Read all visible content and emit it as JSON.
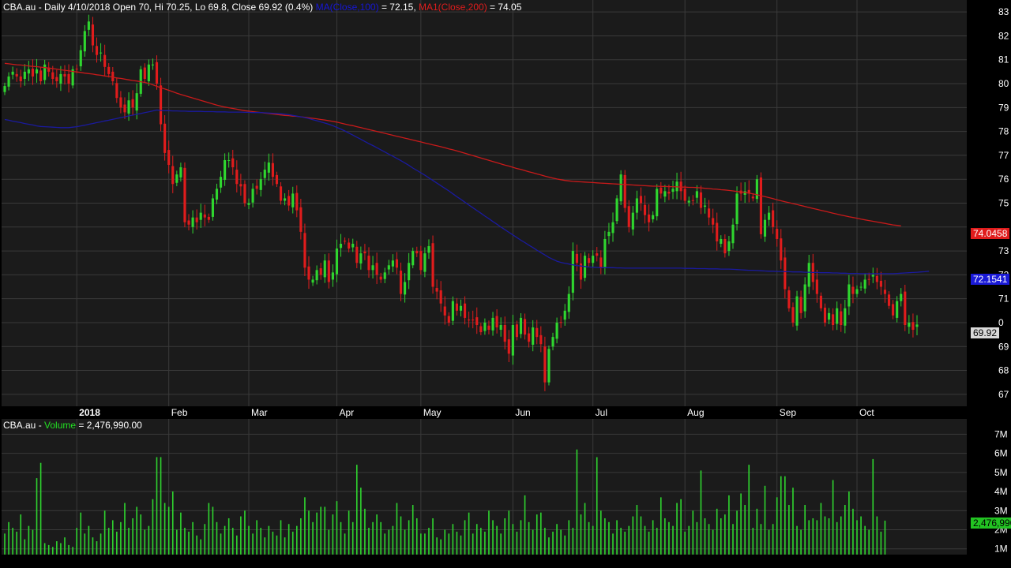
{
  "header": {
    "symbol": "CBA.au",
    "quote_text": " - Daily 4/10/2018 Open 70, Hi 70.25, Lo 69.8, Close 69.92 (0.4%) ",
    "ma100_label": "MA(Close,100)",
    "ma100_value_text": " = 72.15, ",
    "ma200_label": "MA1(Close,200)",
    "ma200_value_text": " = 74.05"
  },
  "volume_header": {
    "symbol": "CBA.au",
    "separator": " - ",
    "label": "Volume",
    "value_text": " = 2,476,990.00"
  },
  "badges": {
    "ma200": "74.0458",
    "ma100": "72.1541",
    "last_close": "69.92",
    "volume": "2,476,990"
  },
  "colors": {
    "background": "#000000",
    "panel": "#1b1b1b",
    "grid": "#3a3a3a",
    "up": "#2fd62f",
    "down": "#e01c1c",
    "ma100": "#1a1a9e",
    "ma200": "#c81a1a",
    "volume": "#2fd62f",
    "text": "#ffffff"
  },
  "chart_data": [
    {
      "type": "candlestick",
      "title": "CBA.au Daily",
      "ylim": [
        66.5,
        83.5
      ],
      "y_ticks": [
        67,
        68,
        69,
        70,
        71,
        72,
        73,
        74,
        75,
        76,
        77,
        78,
        79,
        80,
        81,
        82,
        83
      ],
      "y_tick_labels": [
        "67",
        "68",
        "69",
        "0",
        "71",
        "72",
        "73",
        "",
        "75",
        "76",
        "77",
        "78",
        "79",
        "80",
        "81",
        "82",
        "83"
      ],
      "x_month_labels": [
        {
          "label": "2018",
          "bar": 18
        },
        {
          "label": "Feb",
          "bar": 41
        },
        {
          "label": "Mar",
          "bar": 61
        },
        {
          "label": "Apr",
          "bar": 83
        },
        {
          "label": "May",
          "bar": 104
        },
        {
          "label": "Jun",
          "bar": 127
        },
        {
          "label": "Jul",
          "bar": 147
        },
        {
          "label": "Aug",
          "bar": 170
        },
        {
          "label": "Sep",
          "bar": 193
        },
        {
          "label": "Oct",
          "bar": 213
        }
      ],
      "close": [
        79.9,
        80.3,
        80.5,
        80.3,
        80.1,
        80.5,
        80.6,
        80.3,
        80.6,
        80.1,
        80.8,
        80.5,
        80.2,
        80.1,
        80.4,
        80.3,
        80.0,
        80.6,
        80.6,
        81.4,
        82.2,
        82.6,
        81.6,
        81.2,
        81.3,
        80.7,
        80.4,
        80.1,
        79.4,
        79.0,
        78.8,
        79.3,
        79.0,
        79.6,
        80.6,
        80.2,
        80.8,
        80.8,
        80.0,
        78.3,
        77.1,
        76.6,
        75.8,
        76.2,
        76.5,
        74.2,
        74.1,
        74.4,
        74.2,
        74.6,
        74.4,
        74.3,
        75.2,
        75.6,
        76.1,
        76.8,
        76.8,
        76.5,
        75.8,
        75.7,
        75.0,
        75.0,
        75.6,
        75.6,
        76.0,
        76.4,
        76.7,
        76.1,
        75.8,
        75.1,
        75.2,
        74.9,
        75.4,
        74.7,
        73.8,
        72.3,
        71.8,
        71.8,
        72.2,
        72.0,
        72.6,
        71.7,
        72.1,
        73.1,
        73.3,
        73.4,
        73.1,
        73.3,
        72.5,
        72.9,
        72.9,
        72.2,
        72.4,
        72.0,
        71.8,
        72.1,
        72.4,
        72.6,
        72.3,
        71.2,
        71.7,
        72.5,
        73.0,
        72.9,
        72.2,
        72.9,
        73.2,
        71.5,
        71.3,
        70.8,
        70.3,
        70.0,
        70.9,
        70.5,
        70.7,
        70.2,
        70.1,
        70.1,
        69.9,
        69.6,
        70.0,
        69.7,
        70.2,
        69.8,
        69.9,
        69.2,
        68.7,
        69.9,
        69.4,
        70.2,
        69.5,
        69.2,
        69.8,
        69.4,
        69.1,
        67.5,
        68.9,
        69.4,
        70.0,
        70.0,
        70.5,
        71.2,
        73.0,
        72.5,
        71.8,
        72.8,
        72.5,
        72.8,
        72.8,
        72.3,
        73.5,
        73.8,
        74.2,
        75.2,
        76.2,
        74.8,
        74.0,
        74.6,
        75.2,
        75.0,
        74.5,
        74.2,
        74.5,
        75.6,
        75.4,
        75.5,
        75.4,
        75.6,
        75.9,
        75.5,
        75.1,
        75.1,
        75.1,
        75.5,
        74.8,
        74.9,
        74.4,
        74.1,
        73.4,
        73.5,
        72.9,
        73.4,
        74.1,
        75.4,
        75.4,
        75.5,
        75.4,
        75.2,
        76.0,
        73.7,
        74.3,
        74.6,
        74.0,
        73.5,
        72.6,
        71.4,
        70.6,
        70.0,
        71.1,
        70.4,
        71.6,
        72.5,
        71.7,
        71.2,
        70.6,
        70.0,
        70.4,
        69.9,
        70.6,
        69.9,
        70.6,
        71.6,
        71.2,
        71.4,
        71.5,
        71.8,
        71.8,
        72.0,
        71.7,
        71.5,
        71.2,
        70.7,
        70.3,
        70.9,
        71.2,
        69.9,
        70.0,
        69.7,
        69.92
      ],
      "ma100": [
        78.5,
        78.47,
        78.43,
        78.4,
        78.37,
        78.33,
        78.3,
        78.27,
        78.23,
        78.21,
        78.2,
        78.19,
        78.18,
        78.17,
        78.16,
        78.16,
        78.16,
        78.18,
        78.2,
        78.23,
        78.26,
        78.3,
        78.33,
        78.37,
        78.4,
        78.44,
        78.47,
        78.51,
        78.54,
        78.58,
        78.61,
        78.65,
        78.68,
        78.72,
        78.75,
        78.79,
        78.82,
        78.86,
        78.9,
        78.88,
        78.87,
        78.87,
        78.86,
        78.86,
        78.85,
        78.85,
        78.84,
        78.84,
        78.84,
        78.84,
        78.83,
        78.83,
        78.83,
        78.82,
        78.82,
        78.82,
        78.81,
        78.81,
        78.81,
        78.81,
        78.8,
        78.8,
        78.79,
        78.79,
        78.79,
        78.78,
        78.77,
        78.76,
        78.75,
        78.74,
        78.72,
        78.7,
        78.67,
        78.64,
        78.61,
        78.58,
        78.54,
        78.49,
        78.45,
        78.4,
        78.35,
        78.3,
        78.24,
        78.17,
        78.1,
        78.02,
        77.93,
        77.85,
        77.76,
        77.67,
        77.58,
        77.49,
        77.41,
        77.32,
        77.23,
        77.14,
        77.05,
        76.96,
        76.87,
        76.78,
        76.68,
        76.58,
        76.47,
        76.37,
        76.27,
        76.17,
        76.06,
        75.95,
        75.84,
        75.73,
        75.62,
        75.51,
        75.39,
        75.27,
        75.16,
        75.04,
        74.92,
        74.81,
        74.69,
        74.58,
        74.46,
        74.35,
        74.23,
        74.12,
        74.0,
        73.89,
        73.78,
        73.67,
        73.56,
        73.45,
        73.35,
        73.24,
        73.14,
        73.03,
        72.93,
        72.83,
        72.73,
        72.65,
        72.57,
        72.52,
        72.48,
        72.45,
        72.42,
        72.39,
        72.37,
        72.35,
        72.33,
        72.32,
        72.31,
        72.3,
        72.3,
        72.3,
        72.3,
        72.29,
        72.29,
        72.28,
        72.28,
        72.28,
        72.28,
        72.28,
        72.28,
        72.28,
        72.28,
        72.28,
        72.28,
        72.28,
        72.28,
        72.28,
        72.28,
        72.28,
        72.27,
        72.27,
        72.27,
        72.26,
        72.26,
        72.26,
        72.25,
        72.25,
        72.25,
        72.24,
        72.24,
        72.24,
        72.23,
        72.22,
        72.21,
        72.2,
        72.19,
        72.19,
        72.18,
        72.17,
        72.16,
        72.15,
        72.15,
        72.14,
        72.14,
        72.13,
        72.13,
        72.12,
        72.12,
        72.12,
        72.11,
        72.11,
        72.1,
        72.1,
        72.09,
        72.09,
        72.09,
        72.08,
        72.08,
        72.07,
        72.07,
        72.06,
        72.06,
        72.06,
        72.05,
        72.05,
        72.05,
        72.05,
        72.05,
        72.05,
        72.05,
        72.05,
        72.05,
        72.06,
        72.07,
        72.08,
        72.09,
        72.1,
        72.11,
        72.12,
        72.13,
        72.15
      ],
      "ma200": [
        80.85,
        80.83,
        80.81,
        80.79,
        80.78,
        80.76,
        80.74,
        80.72,
        80.71,
        80.69,
        80.67,
        80.65,
        80.63,
        80.61,
        80.58,
        80.56,
        80.54,
        80.51,
        80.49,
        80.47,
        80.44,
        80.42,
        80.4,
        80.37,
        80.35,
        80.32,
        80.3,
        80.27,
        80.24,
        80.22,
        80.19,
        80.16,
        80.13,
        80.11,
        80.08,
        80.05,
        80.01,
        79.95,
        79.89,
        79.83,
        79.78,
        79.72,
        79.66,
        79.6,
        79.55,
        79.5,
        79.45,
        79.4,
        79.35,
        79.3,
        79.25,
        79.2,
        79.15,
        79.1,
        79.06,
        79.02,
        78.99,
        78.96,
        78.93,
        78.9,
        78.87,
        78.85,
        78.83,
        78.81,
        78.79,
        78.77,
        78.75,
        78.73,
        78.71,
        78.69,
        78.67,
        78.66,
        78.64,
        78.63,
        78.61,
        78.59,
        78.57,
        78.55,
        78.53,
        78.5,
        78.48,
        78.45,
        78.42,
        78.39,
        78.35,
        78.31,
        78.27,
        78.24,
        78.2,
        78.16,
        78.12,
        78.08,
        78.04,
        78.0,
        77.96,
        77.92,
        77.88,
        77.84,
        77.8,
        77.76,
        77.72,
        77.68,
        77.64,
        77.6,
        77.56,
        77.52,
        77.48,
        77.44,
        77.4,
        77.36,
        77.32,
        77.27,
        77.23,
        77.19,
        77.14,
        77.09,
        77.04,
        76.99,
        76.94,
        76.89,
        76.84,
        76.79,
        76.74,
        76.69,
        76.64,
        76.59,
        76.55,
        76.5,
        76.45,
        76.41,
        76.36,
        76.31,
        76.27,
        76.22,
        76.18,
        76.13,
        76.09,
        76.05,
        76.01,
        75.98,
        75.95,
        75.93,
        75.91,
        75.9,
        75.89,
        75.88,
        75.87,
        75.86,
        75.85,
        75.84,
        75.83,
        75.82,
        75.81,
        75.8,
        75.79,
        75.78,
        75.77,
        75.76,
        75.75,
        75.74,
        75.73,
        75.72,
        75.71,
        75.71,
        75.7,
        75.7,
        75.69,
        75.69,
        75.68,
        75.67,
        75.67,
        75.66,
        75.66,
        75.65,
        75.64,
        75.62,
        75.61,
        75.59,
        75.58,
        75.56,
        75.55,
        75.53,
        75.51,
        75.49,
        75.47,
        75.45,
        75.42,
        75.39,
        75.35,
        75.31,
        75.27,
        75.23,
        75.19,
        75.14,
        75.1,
        75.06,
        75.02,
        74.98,
        74.94,
        74.9,
        74.86,
        74.82,
        74.78,
        74.74,
        74.7,
        74.66,
        74.62,
        74.58,
        74.54,
        74.5,
        74.47,
        74.43,
        74.4,
        74.37,
        74.33,
        74.3,
        74.27,
        74.24,
        74.21,
        74.18,
        74.15,
        74.12,
        74.09,
        74.07,
        74.05
      ]
    },
    {
      "type": "bar",
      "title": "Volume",
      "ylim": [
        700000,
        7800000
      ],
      "y_ticks": [
        1000000,
        2000000,
        3000000,
        4000000,
        5000000,
        6000000,
        7000000
      ],
      "y_tick_labels": [
        "1M",
        "2M",
        "3M",
        "4M",
        "5M",
        "6M",
        "7M"
      ],
      "values": [
        1800000,
        2400000,
        2100000,
        1900000,
        2800000,
        1500000,
        2200000,
        2000000,
        4700000,
        5500000,
        1300000,
        1200000,
        1100000,
        1400000,
        1300000,
        1600000,
        1200000,
        1100000,
        2100000,
        2900000,
        1800000,
        2200000,
        1600000,
        1400000,
        1800000,
        3000000,
        2100000,
        2500000,
        1900000,
        2400000,
        3400000,
        2100000,
        2600000,
        3200000,
        2800000,
        2000000,
        2200000,
        3600000,
        5800000,
        5800000,
        3400000,
        3200000,
        4000000,
        2000000,
        2900000,
        2100000,
        1900000,
        2400000,
        1700000,
        1500000,
        2300000,
        3400000,
        3200000,
        2400000,
        1800000,
        2200000,
        2600000,
        2100000,
        1700000,
        2700000,
        3000000,
        2200000,
        1800000,
        2500000,
        2100000,
        1600000,
        2200000,
        1900000,
        1700000,
        2500000,
        1600000,
        2300000,
        1900000,
        2200000,
        2600000,
        3700000,
        3000000,
        2400000,
        2900000,
        3200000,
        3200000,
        2000000,
        2800000,
        3500000,
        2400000,
        1800000,
        3000000,
        2400000,
        5400000,
        4200000,
        3100000,
        2100000,
        2400000,
        2800000,
        2400000,
        1800000,
        2000000,
        2200000,
        3400000,
        2700000,
        2000000,
        2500000,
        3300000,
        2600000,
        1800000,
        1800000,
        2100000,
        2600000,
        1600000,
        1500000,
        2000000,
        1800000,
        2300000,
        1900000,
        1700000,
        2500000,
        2900000,
        1800000,
        2300000,
        2100000,
        1900000,
        3000000,
        2500000,
        2200000,
        1800000,
        2600000,
        3000000,
        2300000,
        1900000,
        2500000,
        3800000,
        2400000,
        2000000,
        2800000,
        2900000,
        2100000,
        1600000,
        1900000,
        2300000,
        2000000,
        1700000,
        2500000,
        2100000,
        6200000,
        2800000,
        3400000,
        2400000,
        2200000,
        5800000,
        3000000,
        2600000,
        2400000,
        1800000,
        2500000,
        2100000,
        1900000,
        2200000,
        2700000,
        3300000,
        2700000,
        2200000,
        1900000,
        2500000,
        2100000,
        3700000,
        2600000,
        2400000,
        2200000,
        3400000,
        3600000,
        1900000,
        2200000,
        3000000,
        2400000,
        5100000,
        2600000,
        2300000,
        2000000,
        3100000,
        2600000,
        2800000,
        3800000,
        2300000,
        3000000,
        3900000,
        3300000,
        5400000,
        2100000,
        3100000,
        2300000,
        4300000,
        2000000,
        2300000,
        3700000,
        4800000,
        4800000,
        3300000,
        4200000,
        2200000,
        2000000,
        3300000,
        2500000,
        2600000,
        2500000,
        3400000,
        2700000,
        2600000,
        4600000,
        2400000,
        2700000,
        3300000,
        4000000,
        3100000,
        2500000,
        2700000,
        2200000,
        2000000,
        5700000,
        2700000,
        1900000,
        2476990
      ]
    }
  ]
}
